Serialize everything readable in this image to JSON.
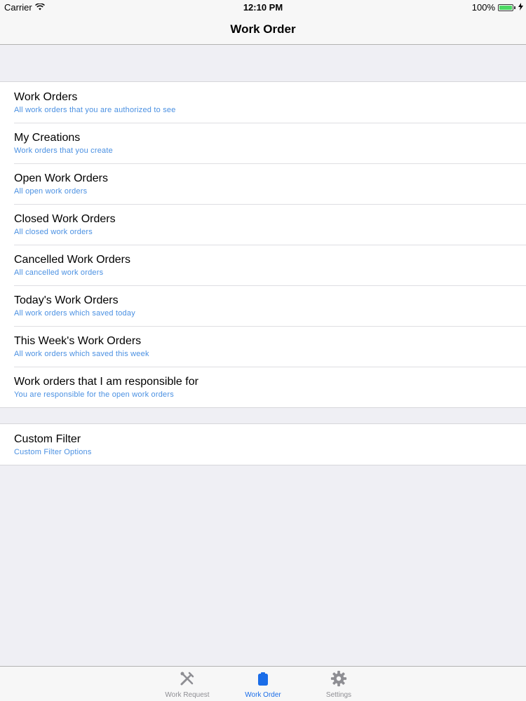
{
  "status_bar": {
    "carrier": "Carrier",
    "time": "12:10 PM",
    "battery": "100%"
  },
  "nav": {
    "title": "Work Order"
  },
  "filters": [
    {
      "title": "Work Orders",
      "subtitle": "All work orders that you are authorized to see"
    },
    {
      "title": "My Creations",
      "subtitle": "Work orders that you create"
    },
    {
      "title": "Open Work Orders",
      "subtitle": "All open work orders"
    },
    {
      "title": "Closed Work Orders",
      "subtitle": "All closed work orders"
    },
    {
      "title": "Cancelled Work Orders",
      "subtitle": "All cancelled work orders"
    },
    {
      "title": "Today's Work Orders",
      "subtitle": "All work orders which saved today"
    },
    {
      "title": "This Week's Work Orders",
      "subtitle": "All work orders which saved this week"
    },
    {
      "title": "Work orders that I am responsible for",
      "subtitle": "You are responsible for the open work orders"
    }
  ],
  "custom": {
    "title": "Custom Filter",
    "subtitle": "Custom Filter Options"
  },
  "tabs": [
    {
      "label": "Work Request",
      "icon": "tools-icon",
      "active": false
    },
    {
      "label": "Work Order",
      "icon": "clipboard-icon",
      "active": true
    },
    {
      "label": "Settings",
      "icon": "gear-icon",
      "active": false
    }
  ],
  "colors": {
    "accent": "#1a6de8",
    "subtitle": "#4a90e2",
    "battery": "#4cd964"
  }
}
